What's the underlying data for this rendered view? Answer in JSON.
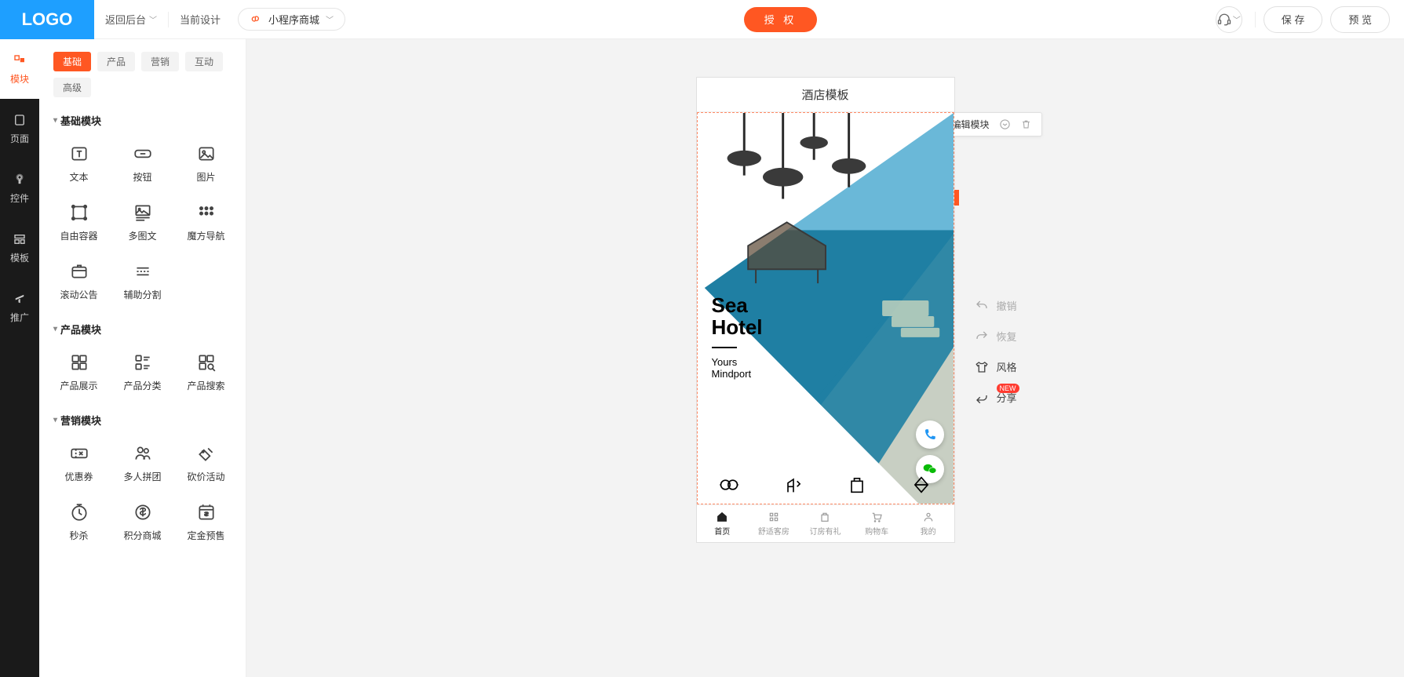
{
  "topbar": {
    "logo": "LOGO",
    "back": "返回后台",
    "currentDesign": "当前设计",
    "designName": "小程序商城",
    "auth": "授 权",
    "save": "保 存",
    "preview": "预 览"
  },
  "rail": [
    {
      "label": "模块",
      "active": true
    },
    {
      "label": "页面",
      "active": false
    },
    {
      "label": "控件",
      "active": false
    },
    {
      "label": "模板",
      "active": false
    },
    {
      "label": "推广",
      "active": false
    }
  ],
  "tabs": [
    {
      "label": "基础",
      "active": true
    },
    {
      "label": "产品",
      "active": false
    },
    {
      "label": "营销",
      "active": false
    },
    {
      "label": "互动",
      "active": false
    },
    {
      "label": "高级",
      "active": false
    }
  ],
  "sections": [
    {
      "title": "基础模块",
      "items": [
        "文本",
        "按钮",
        "图片",
        "自由容器",
        "多图文",
        "魔方导航",
        "滚动公告",
        "辅助分割"
      ]
    },
    {
      "title": "产品模块",
      "items": [
        "产品展示",
        "产品分类",
        "产品搜索"
      ]
    },
    {
      "title": "营销模块",
      "items": [
        "优惠券",
        "多人拼团",
        "砍价活动",
        "秒杀",
        "积分商城",
        "定金预售"
      ]
    }
  ],
  "phone": {
    "title": "酒店模板",
    "heroTitle1": "Sea",
    "heroTitle2": "Hotel",
    "heroSub1": "Yours",
    "heroSub2": "Mindport",
    "tabbar": [
      {
        "label": "首页",
        "active": true
      },
      {
        "label": "舒适客房",
        "active": false
      },
      {
        "label": "订房有礼",
        "active": false
      },
      {
        "label": "购物车",
        "active": false
      },
      {
        "label": "我的",
        "active": false
      }
    ]
  },
  "editpop": {
    "label": "编辑模块"
  },
  "rtools": [
    {
      "label": "撤销",
      "icon": "undo",
      "muted": true
    },
    {
      "label": "恢复",
      "icon": "redo",
      "muted": true
    },
    {
      "label": "风格",
      "icon": "shirt",
      "muted": false
    },
    {
      "label": "分享",
      "icon": "share",
      "muted": false,
      "new": "NEW"
    }
  ]
}
